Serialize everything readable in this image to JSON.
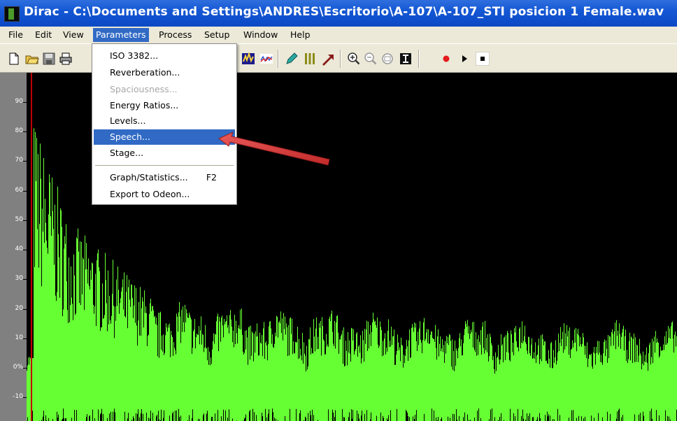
{
  "window": {
    "title": "Dirac - C:\\Documents and Settings\\ANDRES\\Escritorio\\A-107\\A-107_STI posicion 1 Female.wav"
  },
  "menubar": {
    "items": [
      "File",
      "Edit",
      "View",
      "Parameters",
      "Process",
      "Setup",
      "Window",
      "Help"
    ],
    "active": "Parameters"
  },
  "parameters_menu": {
    "items": [
      {
        "label": "ISO 3382...",
        "enabled": true
      },
      {
        "label": "Reverberation...",
        "enabled": true
      },
      {
        "label": "Spaciousness...",
        "enabled": false
      },
      {
        "label": "Energy Ratios...",
        "enabled": true
      },
      {
        "label": "Levels...",
        "enabled": true
      },
      {
        "label": "Speech...",
        "enabled": true,
        "highlighted": true
      },
      {
        "label": "Stage...",
        "enabled": true
      },
      {
        "label": "Graph/Statistics...",
        "shortcut": "F2",
        "enabled": true
      },
      {
        "label": "Export to Odeon...",
        "enabled": true
      }
    ]
  },
  "toolbar": {
    "icons": [
      "new-file-icon",
      "open-folder-icon",
      "save-icon",
      "print-icon",
      "spectrogram-icon",
      "waveform-icon",
      "pencil-icon",
      "bars-icon",
      "arrow-icon",
      "zoom-in-icon",
      "zoom-out-icon",
      "zoom-fit-icon",
      "cursor-icon",
      "record-icon",
      "play-icon",
      "stop-icon"
    ]
  },
  "plot": {
    "y_ticks": [
      "90",
      "80",
      "70",
      "60",
      "50",
      "40",
      "30",
      "20",
      "10",
      "0%",
      "-10"
    ],
    "colors": {
      "background": "#000000",
      "trace": "#66ff33",
      "marker": "#cc0000",
      "axis": "#808080"
    }
  },
  "annotation": {
    "arrow_color": "#dd3b3b"
  }
}
